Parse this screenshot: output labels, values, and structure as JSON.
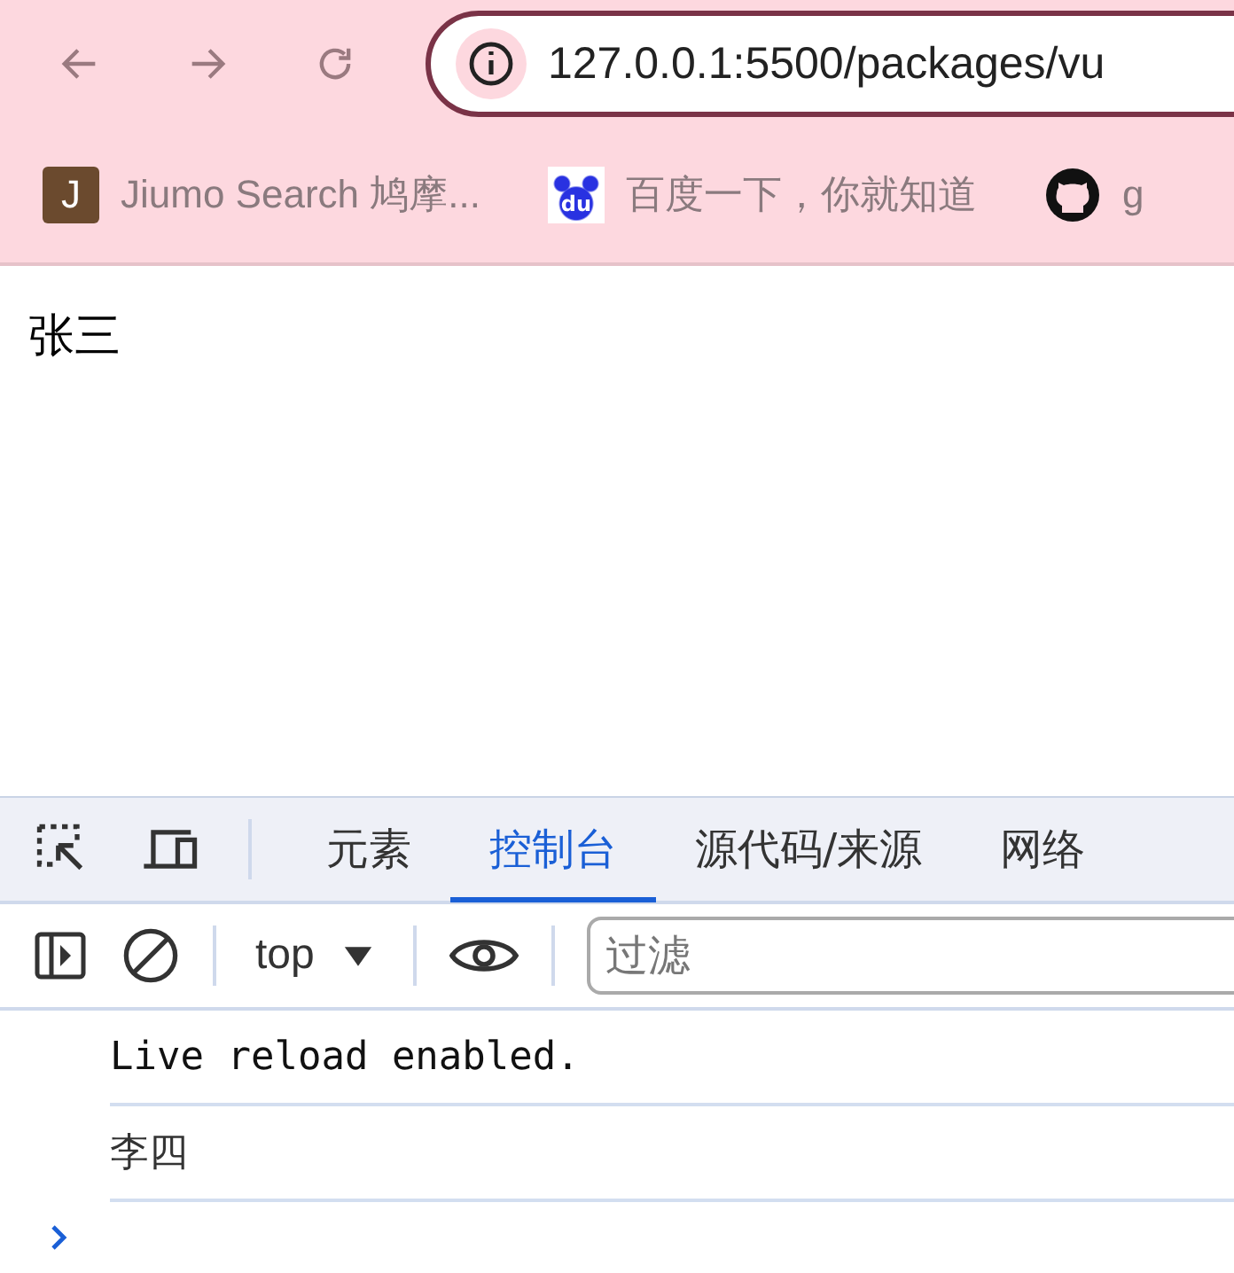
{
  "browser": {
    "url": "127.0.0.1:5500/packages/vu",
    "bookmarks": [
      {
        "kind": "letter",
        "icon_text": "J",
        "label": "Jiumo Search 鸠摩..."
      },
      {
        "kind": "paw",
        "icon_text": "du",
        "label": "百度一下，你就知道"
      },
      {
        "kind": "github",
        "label": "g"
      }
    ]
  },
  "page": {
    "text": "张三"
  },
  "devtools": {
    "tabs": [
      {
        "label": "元素",
        "selected": false
      },
      {
        "label": "控制台",
        "selected": true
      },
      {
        "label": "源代码/来源",
        "selected": false
      },
      {
        "label": "网络",
        "selected": false
      }
    ],
    "context": "top",
    "filter": {
      "placeholder": "过滤"
    },
    "messages": [
      {
        "text": "Live reload enabled.",
        "kind": "mono"
      },
      {
        "text": "李四",
        "kind": "plain"
      }
    ]
  }
}
